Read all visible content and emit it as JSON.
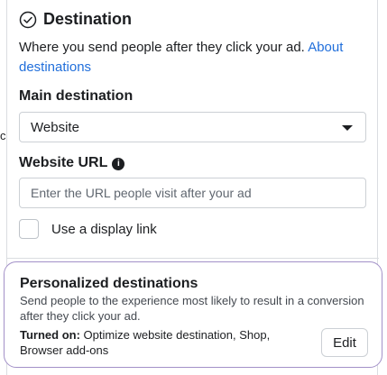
{
  "stray_char": "c",
  "destination": {
    "icon": "check-circle-icon",
    "title": "Destination",
    "description": "Where you send people after they click your ad.",
    "about_link": "About destinations"
  },
  "main_destination": {
    "label": "Main destination",
    "selected": "Website",
    "caret_icon": "caret-down-icon"
  },
  "website_url": {
    "label": "Website URL",
    "info_icon": "info-icon",
    "placeholder": "Enter the URL people visit after your ad",
    "value": ""
  },
  "display_link": {
    "label": "Use a display link",
    "checked": false
  },
  "personalized": {
    "title": "Personalized destinations",
    "description": "Send people to the experience most likely to result in a conversion after they click your ad.",
    "status_label": "Turned on:",
    "status_value": "Optimize website destination, Shop, Browser add-ons",
    "edit_label": "Edit",
    "border_color": "#a391c8"
  },
  "colors": {
    "link": "#216fdb",
    "text": "#1c1e21"
  }
}
